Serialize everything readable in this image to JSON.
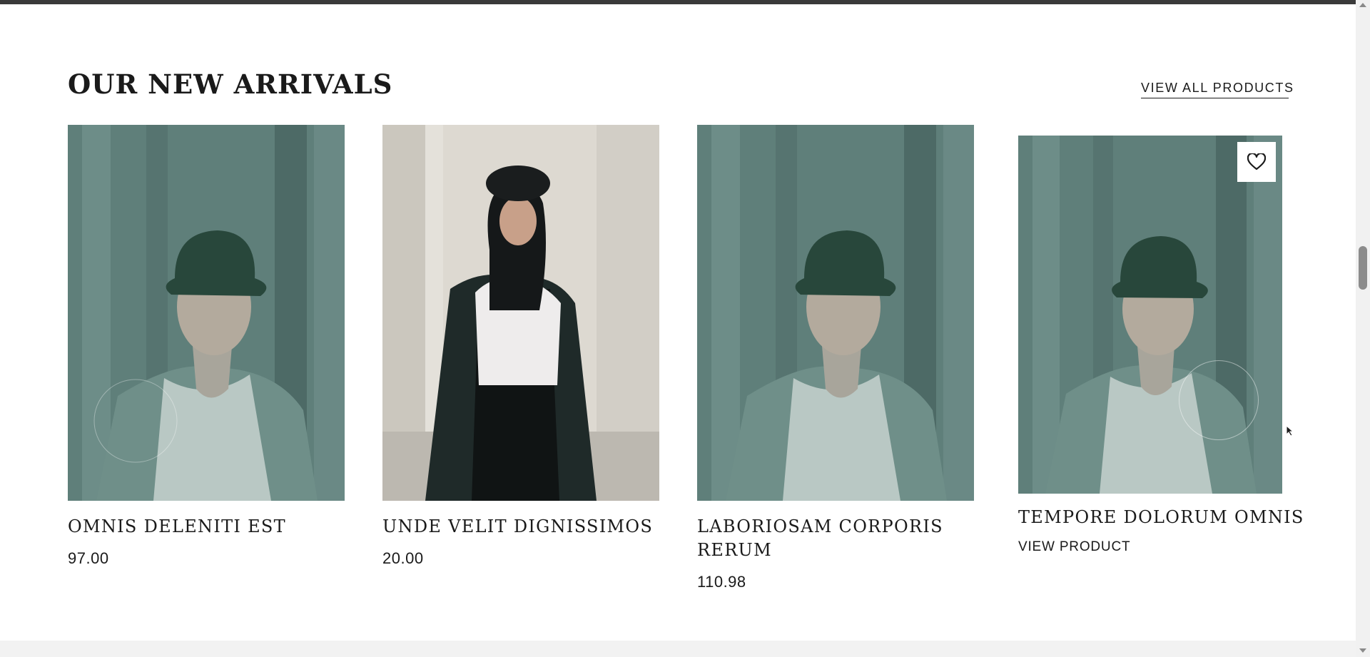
{
  "section": {
    "title": "OUR NEW ARRIVALS",
    "view_all_label": "VIEW ALL PRODUCTS"
  },
  "products": [
    {
      "name": "OMNIS DELENITI EST",
      "price": "97.00"
    },
    {
      "name": "UNDE VELIT DIGNISSIMOS",
      "price": "20.00"
    },
    {
      "name": "LABORIOSAM CORPORIS RERUM",
      "price": "110.98"
    },
    {
      "name": "TEMPORE DOLORUM OMNIS",
      "action_label": "VIEW PRODUCT"
    }
  ],
  "icons": {
    "wishlist": "heart-icon",
    "cursor": "mouse-pointer-icon"
  },
  "colors": {
    "text": "#1a1a1a",
    "photo_backdrop": "#5f7f7a",
    "footer_strip": "#f2f2f2"
  }
}
